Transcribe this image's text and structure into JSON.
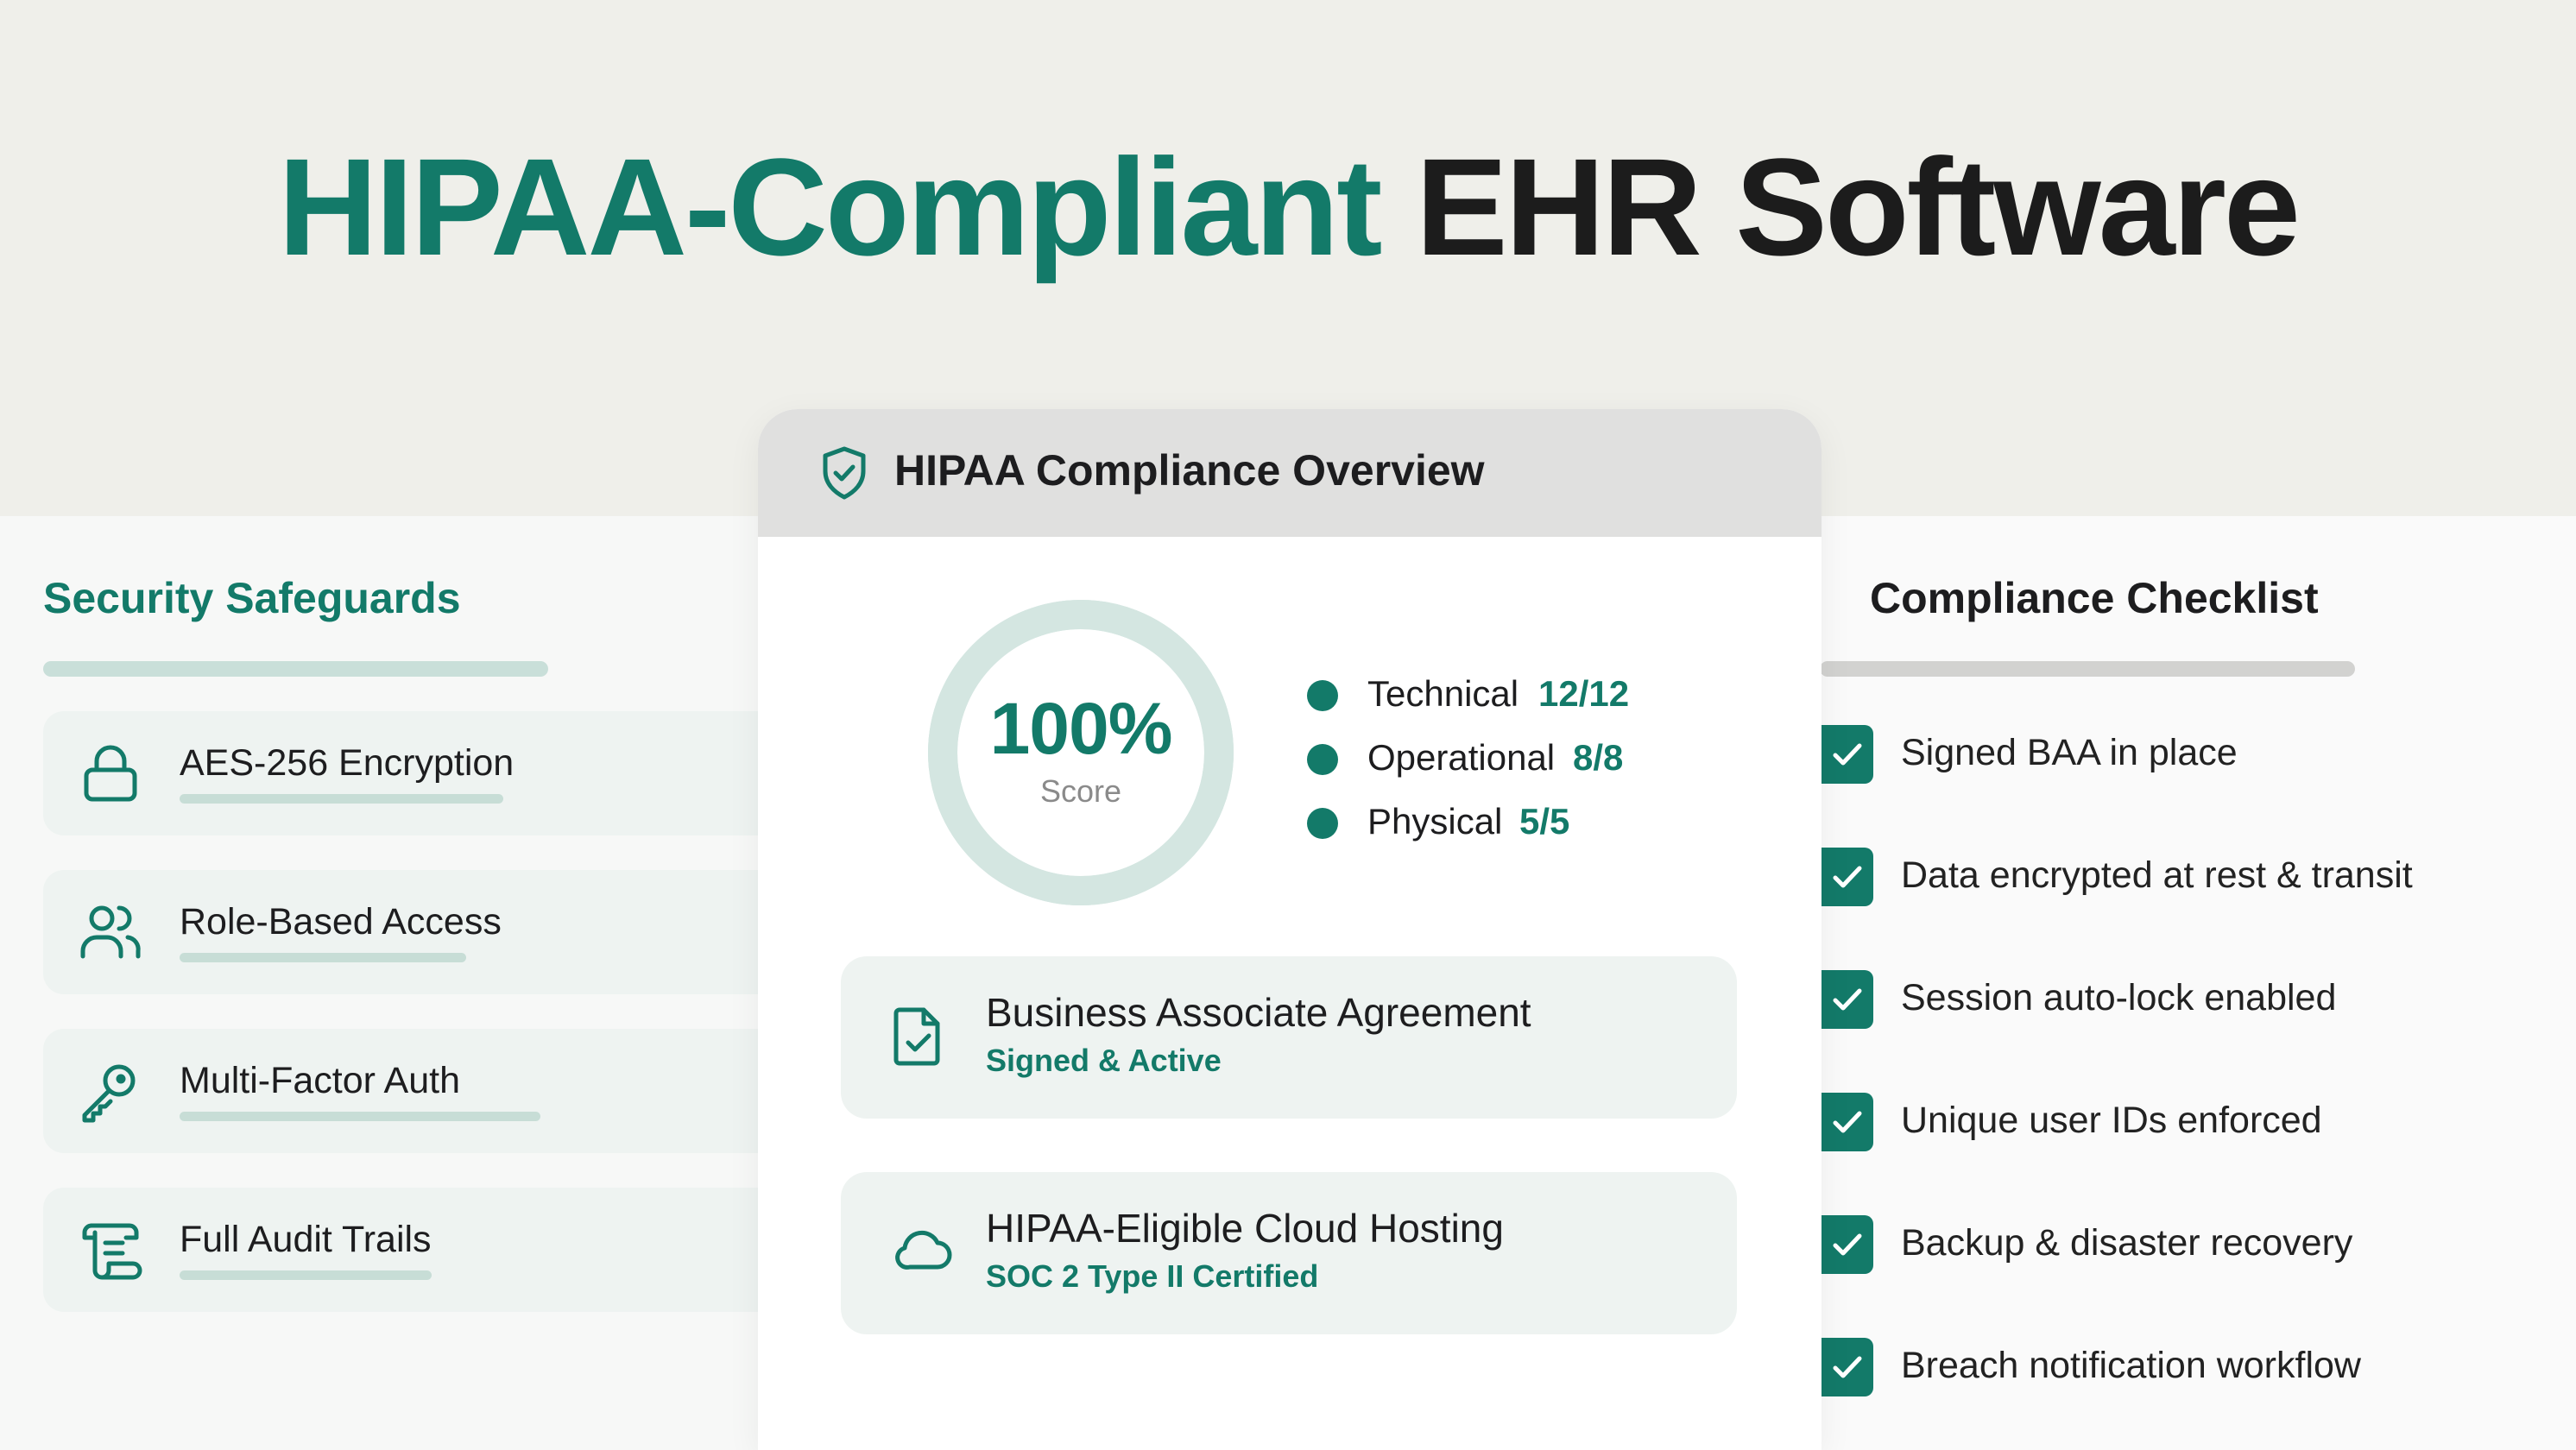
{
  "headline": {
    "accent": "HIPAA-Compliant",
    "rest": "EHR Software"
  },
  "security": {
    "title": "Security Safeguards",
    "items": [
      {
        "label": "AES-256 Encryption",
        "icon": "lock-icon"
      },
      {
        "label": "Role-Based Access",
        "icon": "users-icon"
      },
      {
        "label": "Multi-Factor Auth",
        "icon": "key-icon"
      },
      {
        "label": "Full Audit Trails",
        "icon": "scroll-icon"
      }
    ]
  },
  "overview": {
    "title": "HIPAA Compliance Overview",
    "icon": "shield-check-icon",
    "score": {
      "value": "100%",
      "caption": "Score",
      "fraction": 1.0
    },
    "legend": [
      {
        "name": "Technical",
        "value": "12/12"
      },
      {
        "name": "Operational",
        "value": "8/8"
      },
      {
        "name": "Physical",
        "value": "5/5"
      }
    ],
    "agreements": [
      {
        "title": "Business Associate Agreement",
        "subtitle": "Signed & Active",
        "icon": "document-check-icon"
      },
      {
        "title": "HIPAA-Eligible Cloud Hosting",
        "subtitle": "SOC 2 Type II Certified",
        "icon": "cloud-icon"
      }
    ]
  },
  "checklist": {
    "title": "Compliance Checklist",
    "items": [
      {
        "label": "Signed BAA in place",
        "checked": true
      },
      {
        "label": "Data encrypted at rest & transit",
        "checked": true
      },
      {
        "label": "Session auto-lock enabled",
        "checked": true
      },
      {
        "label": "Unique user IDs enforced",
        "checked": true
      },
      {
        "label": "Backup & disaster recovery",
        "checked": true
      },
      {
        "label": "Breach notification workflow",
        "checked": true
      }
    ]
  },
  "colors": {
    "accent": "#137a69",
    "background": "#efefea",
    "card": "#ffffff",
    "soft_green": "#eef3f1"
  }
}
